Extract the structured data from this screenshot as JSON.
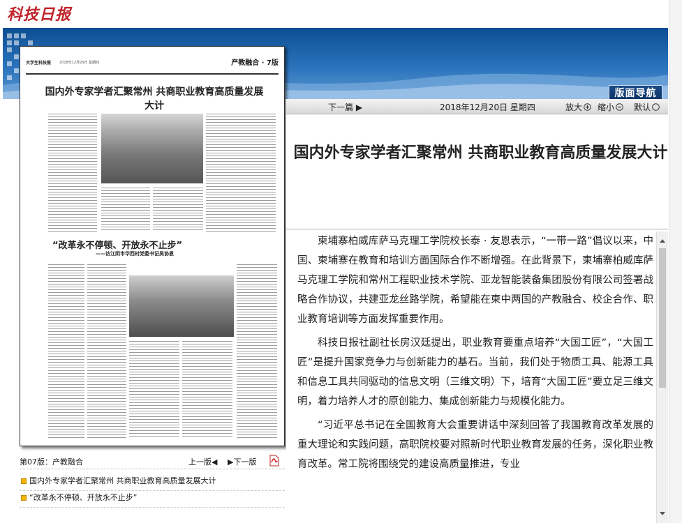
{
  "site": {
    "logo_text": "科技日报",
    "banner_button": "版面导航"
  },
  "paper_preview": {
    "header_name": "大学生科技报",
    "header_date": "2018年12月20日 星期四",
    "section": "产教融合 · 7版",
    "headline": "国内外专家学者汇聚常州 共商职业教育高质量发展大计",
    "headline2": "“改革永不停顿、开放永不止步”",
    "headline2_sub": "——访江阴市华西村党委书记吴协恩"
  },
  "page_meta": {
    "current_page": "第07版：产教融合",
    "prev": "上一版◀",
    "next": "▶下一版"
  },
  "articles": [
    "国内外专家学者汇聚常州 共商职业教育高质量发展大计",
    "“改革永不停顿、开放永不止步”"
  ],
  "toolbar": {
    "next_article": "下一篇 ▶",
    "date": "2018年12月20日  星期四",
    "zoom_in": "放大",
    "zoom_out": "缩小",
    "reset": "默认"
  },
  "article": {
    "title": "国内外专家学者汇聚常州 共商职业教育高质量发展大计",
    "paragraphs": [
      "柬埔寨柏威库萨马克理工学院校长泰 · 友恩表示，“一带一路”倡议以来，中国、柬埔寨在教育和培训方面国际合作不断增强。在此背景下，柬埔寨柏威库萨马克理工学院和常州工程职业技术学院、亚龙智能装备集团股份有限公司签署战略合作协议，共建亚龙丝路学院，希望能在柬中两国的产教融合、校企合作、职业教育培训等方面发挥重要作用。",
      "科技日报社副社长房汉廷提出，职业教育要重点培养“大国工匠”，“大国工匠”是提升国家竞争力与创新能力的基石。当前，我们处于物质工具、能源工具和信息工具共同驱动的信息文明（三维文明）下，培育“大国工匠”要立足三维文明，着力培养人才的原创能力、集成创新能力与规模化能力。",
      "“习近平总书记在全国教育大会重要讲话中深刻回答了我国教育改革发展的重大理论和实践问题，高职院校要对照新时代职业教育发展的任务，深化职业教育改革。常工院将围绕党的建设高质量推进，专业"
    ]
  }
}
